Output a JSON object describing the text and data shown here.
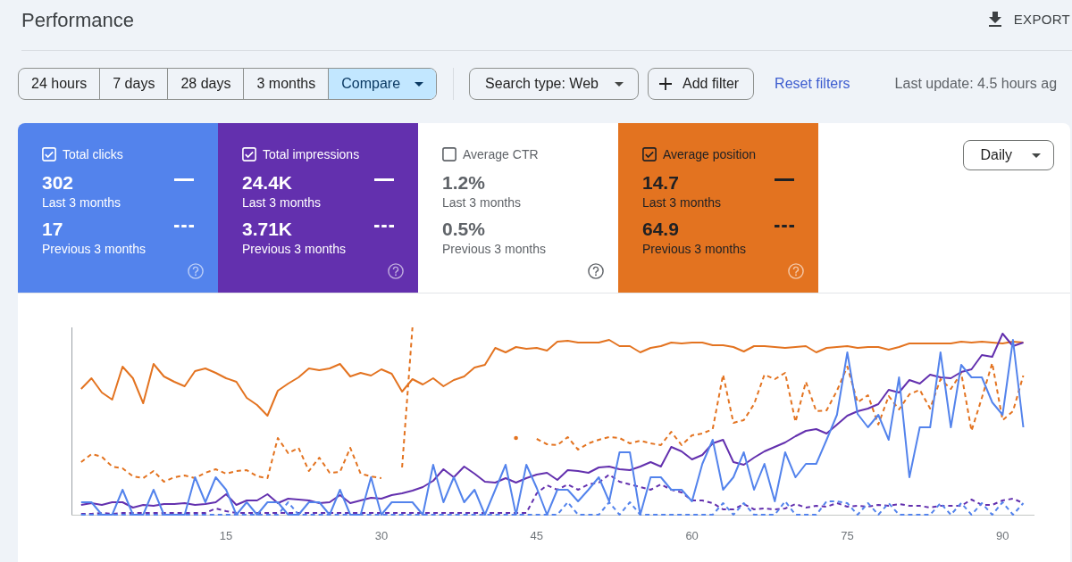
{
  "header": {
    "title": "Performance",
    "export_label": "EXPORT"
  },
  "date_ranges": [
    {
      "label": "24 hours",
      "selected": false,
      "kind": "option"
    },
    {
      "label": "7 days",
      "selected": false,
      "kind": "option"
    },
    {
      "label": "28 days",
      "selected": false,
      "kind": "option"
    },
    {
      "label": "3 months",
      "selected": false,
      "kind": "option"
    },
    {
      "label": "Compare",
      "selected": true,
      "kind": "dropdown"
    }
  ],
  "search_type": "Search type: Web",
  "add_filter": "Add filter",
  "reset_filters": "Reset filters",
  "last_update": "Last update: 4.5 hours ag",
  "metrics": [
    {
      "label": "Total clicks",
      "checked": true,
      "color": "#5383ec",
      "current_value": "302",
      "current_period": "Last 3 months",
      "previous_value": "17",
      "previous_period": "Previous 3 months"
    },
    {
      "label": "Total impressions",
      "checked": true,
      "color": "#6330ae",
      "current_value": "24.4K",
      "current_period": "Last 3 months",
      "previous_value": "3.71K",
      "previous_period": "Previous 3 months"
    },
    {
      "label": "Average CTR",
      "checked": false,
      "current_value": "1.2%",
      "current_period": "Last 3 months",
      "previous_value": "0.5%",
      "previous_period": "Previous 3 months"
    },
    {
      "label": "Average position",
      "checked": true,
      "color": "#e37320",
      "current_value": "14.7",
      "current_period": "Last 3 months",
      "previous_value": "64.9",
      "previous_period": "Previous 3 months"
    }
  ],
  "granularity": "Daily",
  "chart": {
    "x_tick_labels": [
      "15",
      "30",
      "45",
      "60",
      "75",
      "90"
    ]
  }
}
